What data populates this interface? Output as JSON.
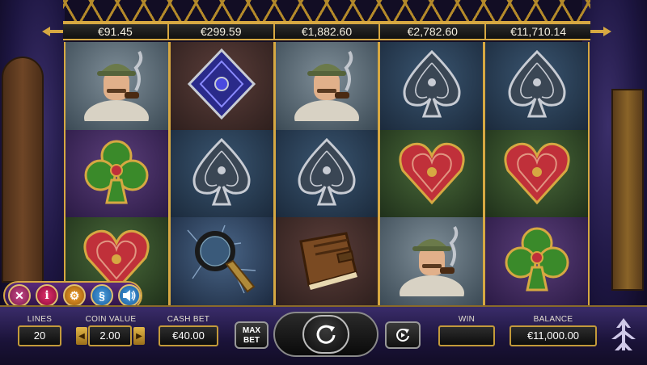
{
  "jackpots": [
    "€91.45",
    "€299.59",
    "€1,882.60",
    "€2,782.60",
    "€11,710.14"
  ],
  "reels": [
    [
      {
        "symbol": "detective-icon",
        "bg": "bg-gray"
      },
      {
        "symbol": "club-icon",
        "bg": "bg-purple"
      },
      {
        "symbol": "heart-icon",
        "bg": "bg-green"
      }
    ],
    [
      {
        "symbol": "diamond-icon",
        "bg": "bg-brick"
      },
      {
        "symbol": "spade-icon",
        "bg": "bg-blue"
      },
      {
        "symbol": "magnifier-icon",
        "bg": "bg-glass"
      }
    ],
    [
      {
        "symbol": "detective-icon",
        "bg": "bg-gray"
      },
      {
        "symbol": "spade-icon",
        "bg": "bg-blue"
      },
      {
        "symbol": "book-icon",
        "bg": "bg-brick"
      }
    ],
    [
      {
        "symbol": "spade-icon",
        "bg": "bg-blue"
      },
      {
        "symbol": "heart-icon",
        "bg": "bg-green"
      },
      {
        "symbol": "detective-icon",
        "bg": "bg-gray"
      }
    ],
    [
      {
        "symbol": "spade-icon",
        "bg": "bg-blue"
      },
      {
        "symbol": "heart-icon",
        "bg": "bg-green"
      },
      {
        "symbol": "club-icon",
        "bg": "bg-purple"
      }
    ]
  ],
  "controls": {
    "lines_label": "LINES",
    "lines_value": "20",
    "coin_value_label": "COIN VALUE",
    "coin_value": "2.00",
    "cash_bet_label": "CASH BET",
    "cash_bet_value": "€40.00",
    "max_bet_label_1": "MAX",
    "max_bet_label_2": "BET",
    "win_label": "WIN",
    "win_value": "",
    "balance_label": "BALANCE",
    "balance_value": "€11,000.00"
  },
  "menu": {
    "close": "✕",
    "info": "i",
    "settings": "⚙",
    "rules": "§",
    "sound": "🔊"
  },
  "colors": {
    "gold": "#d6a842",
    "panel": "#1a1238",
    "heart": "#c0303a",
    "club": "#3a8a2a",
    "spade": "#c8ccd4",
    "diamond": "#3a3ac0"
  }
}
